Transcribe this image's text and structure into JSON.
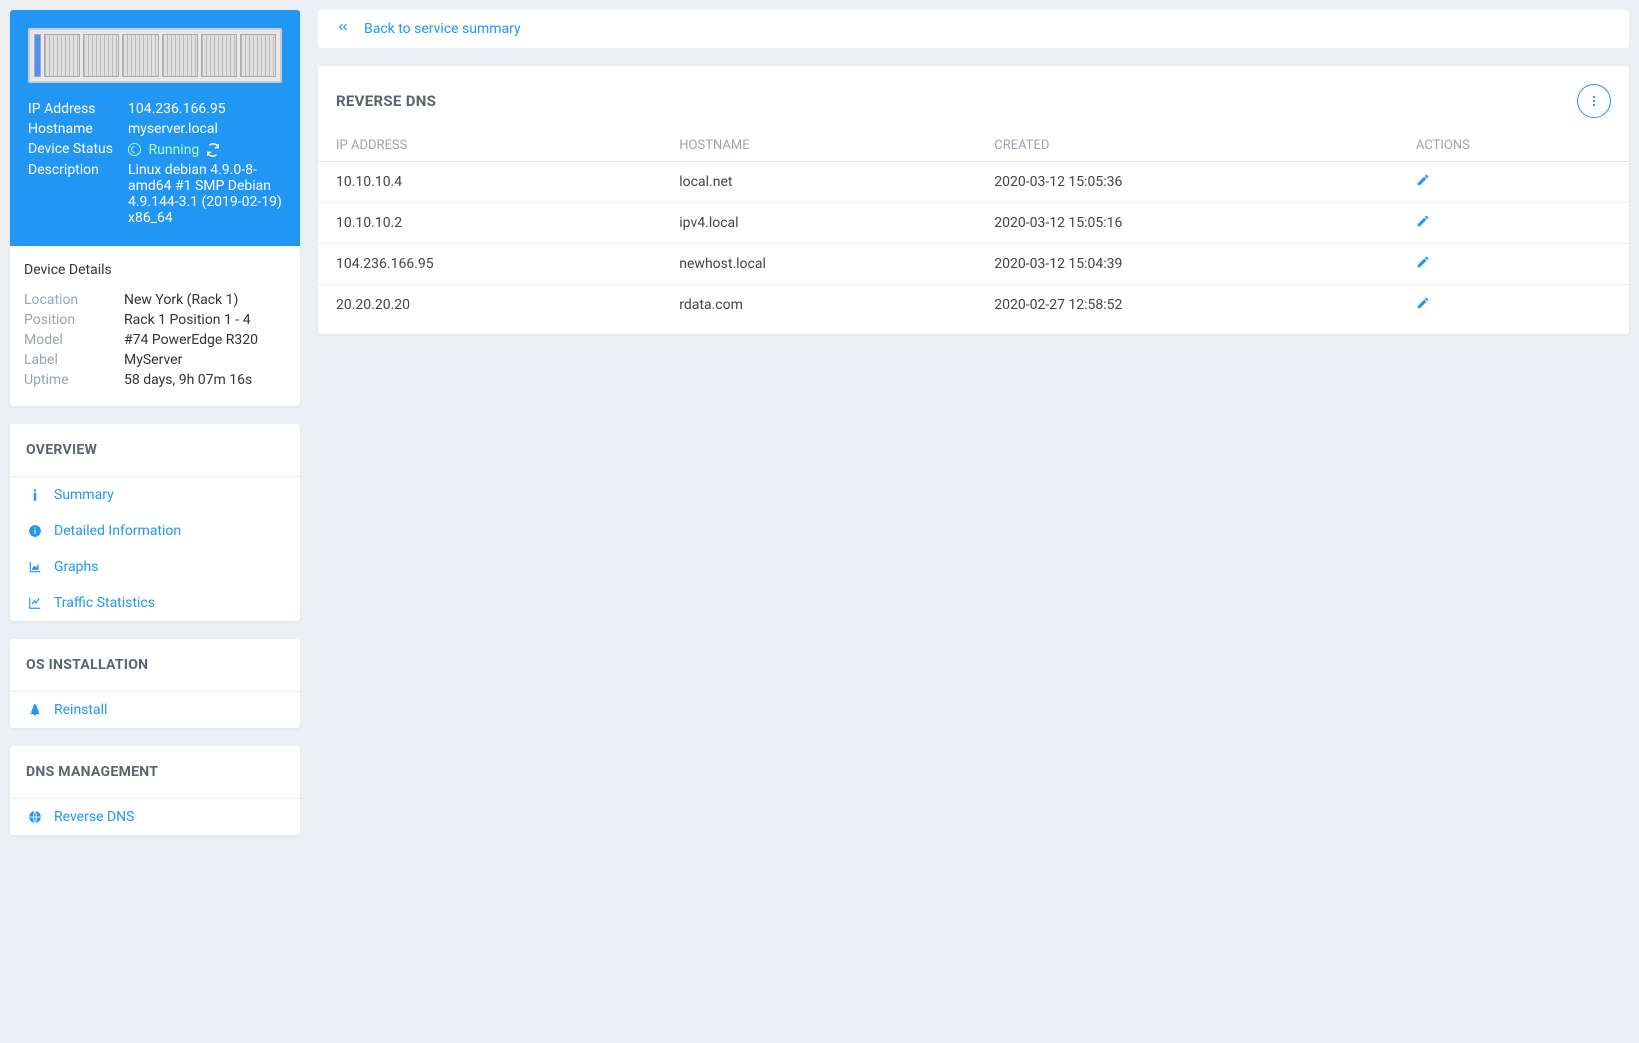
{
  "back_link": "Back to service summary",
  "device_info": {
    "labels": {
      "ip": "IP Address",
      "hostname": "Hostname",
      "status": "Device Status",
      "description": "Description"
    },
    "ip": "104.236.166.95",
    "hostname": "myserver.local",
    "status": "Running",
    "description": "Linux debian 4.9.0-8-amd64 #1 SMP Debian 4.9.144-3.1 (2019-02-19) x86_64"
  },
  "device_details": {
    "title": "Device Details",
    "labels": {
      "location": "Location",
      "position": "Position",
      "model": "Model",
      "label": "Label",
      "uptime": "Uptime"
    },
    "location": "New York (Rack 1)",
    "position": "Rack 1 Position 1 - 4",
    "model": "#74 PowerEdge R320",
    "label": "MyServer",
    "uptime": "58 days, 9h 07m 16s"
  },
  "nav": {
    "overview": {
      "title": "OVERVIEW",
      "summary": "Summary",
      "detailed": "Detailed Information",
      "graphs": "Graphs",
      "traffic": "Traffic Statistics"
    },
    "os": {
      "title": "OS INSTALLATION",
      "reinstall": "Reinstall"
    },
    "dns": {
      "title": "DNS MANAGEMENT",
      "reverse": "Reverse DNS"
    }
  },
  "reverse_dns": {
    "title": "REVERSE DNS",
    "columns": {
      "ip": "IP ADDRESS",
      "hostname": "HOSTNAME",
      "created": "CREATED",
      "actions": "ACTIONS"
    },
    "rows": [
      {
        "ip": "10.10.10.4",
        "hostname": "local.net",
        "created": "2020-03-12 15:05:36"
      },
      {
        "ip": "10.10.10.2",
        "hostname": "ipv4.local",
        "created": "2020-03-12 15:05:16"
      },
      {
        "ip": "104.236.166.95",
        "hostname": "newhost.local",
        "created": "2020-03-12 15:04:39"
      },
      {
        "ip": "20.20.20.20",
        "hostname": "rdata.com",
        "created": "2020-02-27 12:58:52"
      }
    ]
  }
}
